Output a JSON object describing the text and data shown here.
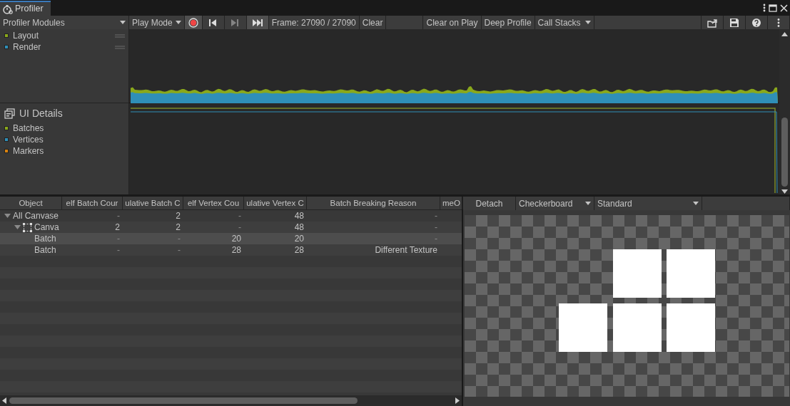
{
  "window": {
    "tab": "Profiler"
  },
  "toolbar": {
    "modules_dropdown": "Profiler Modules",
    "target_dropdown": "Play Mode",
    "record_on": true,
    "frame_buttons": [
      {
        "kind": "previous",
        "disabled": false,
        "on": false
      },
      {
        "kind": "next",
        "disabled": true,
        "on": false
      },
      {
        "kind": "current",
        "disabled": false,
        "on": true
      }
    ],
    "frame": "Frame: 27090 / 27090",
    "clear": "Clear",
    "clear_on_play": {
      "label": "Clear on Play",
      "on": false
    },
    "deep_profile": {
      "label": "Deep Profile",
      "on": false
    },
    "call_stacks": "Call Stacks"
  },
  "modules": [
    {
      "legend": [
        {
          "label": "Layout",
          "color": "#8aa81b"
        },
        {
          "label": "Render",
          "color": "#2f8fb8"
        }
      ]
    },
    {
      "title": "UI Details",
      "legend": [
        {
          "label": "Batches",
          "color": "#8aa81b"
        },
        {
          "label": "Vertices",
          "color": "#2f8fb8"
        },
        {
          "label": "Markers",
          "color": "#d9820f"
        }
      ]
    }
  ],
  "table": {
    "columns": [
      "Object",
      "elf Batch Cour",
      "ulative Batch C",
      "elf Vertex Cou",
      "ulative Vertex C",
      "Batch Breaking Reason",
      "meO"
    ],
    "rows": [
      {
        "kind": "root",
        "cells": [
          "All Canvase",
          "-",
          "2",
          "-",
          "48",
          "-"
        ],
        "expanded": true,
        "selected": false,
        "children": [
          {
            "kind": "canvas",
            "cells": [
              "Canva",
              "2",
              "2",
              "-",
              "48",
              "-"
            ],
            "expanded": true,
            "selected": false,
            "children": [
              {
                "kind": "batch",
                "cells": [
                  "Batch",
                  "-",
                  "-",
                  "20",
                  "20",
                  "-"
                ],
                "selected": true
              },
              {
                "kind": "batch",
                "cells": [
                  "Batch",
                  "-",
                  "-",
                  "28",
                  "28",
                  "Different Texture"
                ],
                "selected": false
              }
            ]
          }
        ]
      }
    ]
  },
  "preview": {
    "detach": "Detach",
    "background_dropdown": "Checkerboard",
    "mode_dropdown": "Standard"
  }
}
